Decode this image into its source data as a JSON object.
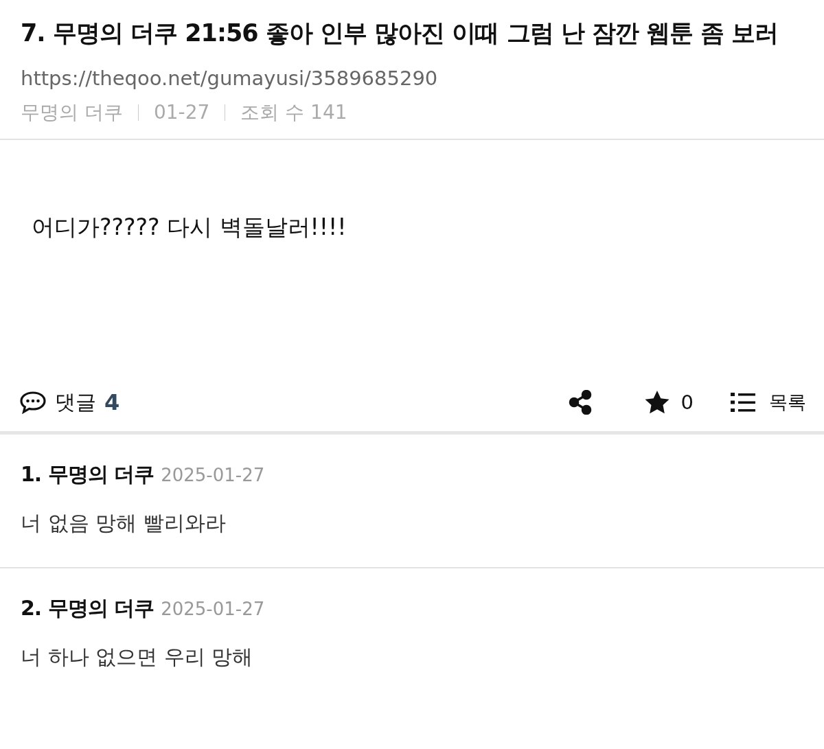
{
  "post": {
    "title": "7. 무명의 더쿠 21:56 좋아 인부 많아진 이때 그럼 난 잠깐 웹툰 좀 보러",
    "url": "https://theqoo.net/gumayusi/3589685290",
    "meta": [
      "무명의 더쿠",
      "01-27",
      "조회 수 141"
    ],
    "body": "어디가????? 다시 벽돌날러!!!!"
  },
  "actions": {
    "comment_label": "댓글",
    "comment_count": "4",
    "star_count": "0",
    "list_label": "목록"
  },
  "comments": [
    {
      "author": "1. 무명의 더쿠",
      "date": "2025-01-27",
      "text": "너 없음 망해 빨리와라"
    },
    {
      "author": "2. 무명의 더쿠",
      "date": "2025-01-27",
      "text": "너 하나 없으면 우리 망해"
    }
  ]
}
